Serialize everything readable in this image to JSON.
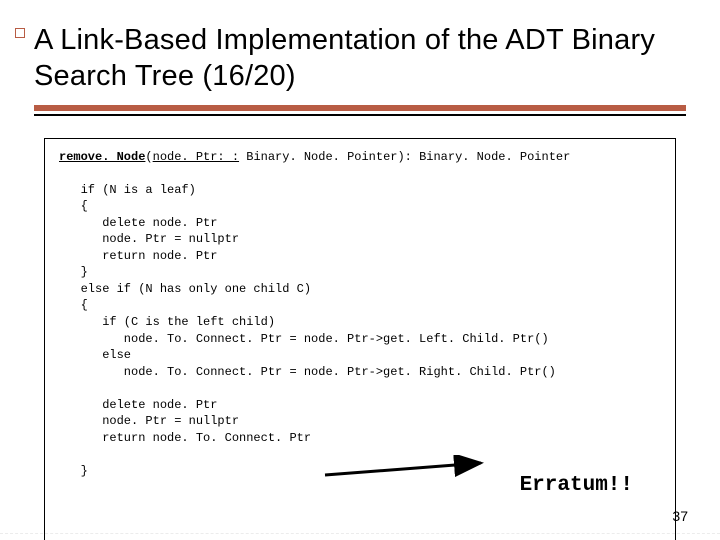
{
  "title": "A Link-Based Implementation of the ADT Binary Search Tree (16/20)",
  "signature": {
    "name": "remove. Node",
    "arg": "node. Ptr: :",
    "rest": " Binary. Node. Pointer): Binary. Node. Pointer"
  },
  "code": {
    "l1": "   if (N is a leaf)",
    "l2": "   {",
    "l3": "      delete node. Ptr",
    "l4": "      node. Ptr = nullptr",
    "l5": "      return node. Ptr",
    "l6": "   }",
    "l7": "   else if (N has only one child C)",
    "l8": "   {",
    "l9": "      if (C is the left child)",
    "l10": "         node. To. Connect. Ptr = node. Ptr->get. Left. Child. Ptr()",
    "l11": "      else",
    "l12": "         node. To. Connect. Ptr = node. Ptr->get. Right. Child. Ptr()",
    "l13": "",
    "l14": "      delete node. Ptr",
    "l15": "      node. Ptr = nullptr",
    "l16": "      return node. To. Connect. Ptr",
    "l17": "",
    "l18": "   }"
  },
  "erratum": "Erratum!!",
  "page": "37"
}
